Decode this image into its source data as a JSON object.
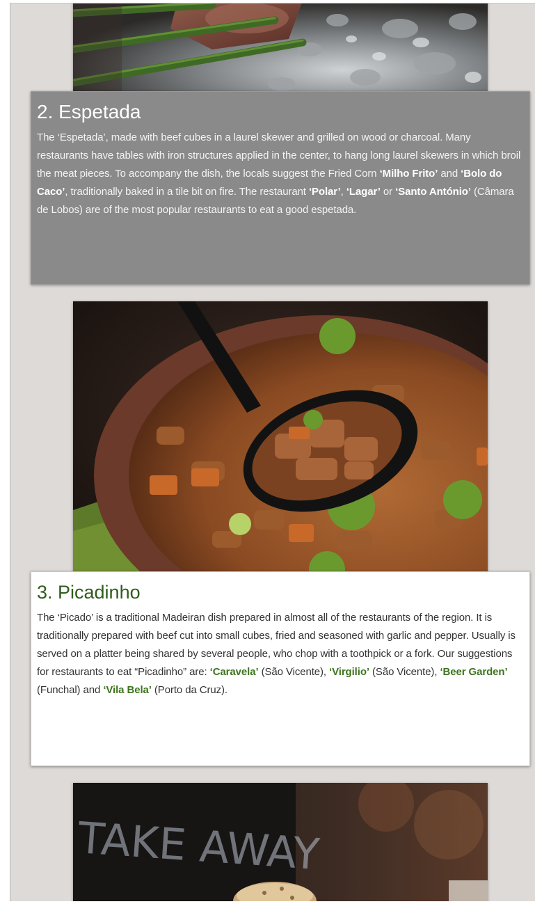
{
  "sections": [
    {
      "heading": "2. Espetada",
      "p": [
        "The ‘Espetada’, made with beef cubes in a laurel skewer and grilled on wood or charcoal. Many restaurants have tables with iron structures applied in the center, to hang long laurel skewers in which broil the meat pieces.  To accompany the dish, the locals suggest the Fried Corn ",
        "‘Milho Frito’",
        " and ",
        "‘Bolo do Caco’",
        ", traditionally baked in a tile bit on fire. The restaurant ",
        "‘Polar’",
        ", ",
        "‘Lagar’",
        " or ",
        "‘Santo António’",
        " (Câmara de Lobos) are of the most popular restaurants to eat a good espetada."
      ]
    },
    {
      "heading": "3. Picadinho",
      "p": [
        "The ‘Picado’ is a traditional Madeiran dish prepared in almost all of the restaurants of the region. It is traditionally prepared with beef cut into small cubes, fried and seasoned with garlic and pepper. Usually is served on a platter being shared by several people, who chop with a toothpick or a fork. Our suggestions for restaurants to eat “Picadinho” are: ",
        "‘Caravela’",
        " (São Vicente), ",
        "‘Virgilio’",
        " (São Vicente), ",
        "‘Beer Garden’",
        " (Funchal) and ",
        "‘Vila Bela’",
        " (Porto da Cruz)."
      ]
    }
  ],
  "images": {
    "espetada_photo": "grilled-meat-skewers-photo",
    "picadinho_photo": "beef-stew-bowl-photo",
    "takeaway_photo": "take-away-sandwich-photo",
    "takeaway_sign_text": "TAKE AWAY"
  },
  "colors": {
    "page_bg": "#dedad7",
    "dark_card": "#8a8a8a",
    "heading_green": "#2f5d1c",
    "highlight_green": "#3e7420"
  }
}
